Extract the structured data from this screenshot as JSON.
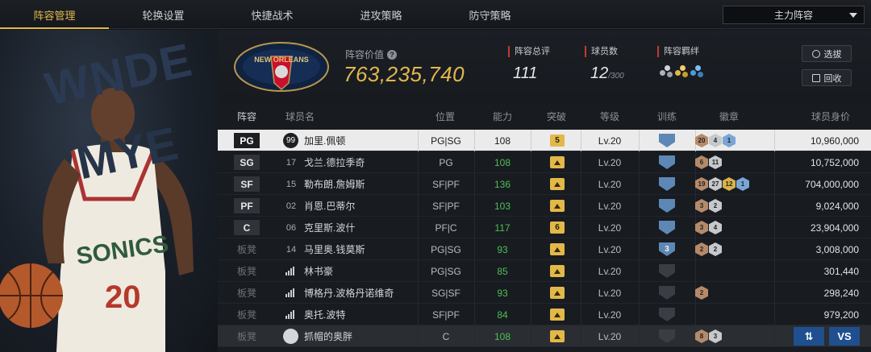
{
  "tabs": [
    "阵容管理",
    "轮换设置",
    "快捷战术",
    "进攻策略",
    "防守策略"
  ],
  "lineup_select": "主力阵容",
  "team_logo_text": "NEW ORLEANS",
  "value_label": "阵容价值",
  "value": "763,235,740",
  "stats": {
    "overall_label": "阵容总评",
    "overall": "111",
    "count_label": "球员数",
    "count": "12",
    "count_max": "/300",
    "synergy_label": "阵容羁绊"
  },
  "buttons": {
    "pick": "选拔",
    "recycle": "回收"
  },
  "headers": {
    "lineup": "阵容",
    "name": "球员名",
    "position": "位置",
    "ability": "能力",
    "break": "突破",
    "level": "等级",
    "train": "训练",
    "badge": "徽章",
    "salary": "球员身价"
  },
  "rows": [
    {
      "slot": "PG",
      "jersey": "99",
      "name": "加里.佩顿",
      "position": "PG|SG",
      "ability": "108",
      "break": "5",
      "level": "Lv.20",
      "train": "",
      "badges": [
        [
          "20",
          "bronze"
        ],
        [
          "4",
          "silver"
        ],
        [
          "1",
          "hof"
        ]
      ],
      "salary": "10,960,000"
    },
    {
      "slot": "SG",
      "jersey": "17",
      "name": "戈兰.德拉季奇",
      "position": "PG",
      "ability": "108",
      "break": "",
      "level": "Lv.20",
      "train": "",
      "badges": [
        [
          "6",
          "bronze"
        ],
        [
          "11",
          "silver"
        ]
      ],
      "salary": "10,752,000"
    },
    {
      "slot": "SF",
      "jersey": "15",
      "name": "勒布朗.詹姆斯",
      "position": "SF|PF",
      "ability": "136",
      "break": "",
      "level": "Lv.20",
      "train": "",
      "badges": [
        [
          "19",
          "bronze"
        ],
        [
          "27",
          "silver"
        ],
        [
          "12",
          "gold"
        ],
        [
          "1",
          "hof"
        ]
      ],
      "salary": "704,000,000"
    },
    {
      "slot": "PF",
      "jersey": "02",
      "name": "肖恩.巴蒂尔",
      "position": "SF|PF",
      "ability": "103",
      "break": "",
      "level": "Lv.20",
      "train": "",
      "badges": [
        [
          "3",
          "bronze"
        ],
        [
          "2",
          "silver"
        ]
      ],
      "salary": "9,024,000"
    },
    {
      "slot": "C",
      "jersey": "06",
      "name": "克里斯.波什",
      "position": "PF|C",
      "ability": "117",
      "break": "6",
      "level": "Lv.20",
      "train": "",
      "badges": [
        [
          "3",
          "bronze"
        ],
        [
          "4",
          "silver"
        ]
      ],
      "salary": "23,904,000"
    },
    {
      "slot": "板凳",
      "jersey": "14",
      "name": "马里奥.钱莫斯",
      "position": "PG|SG",
      "ability": "93",
      "break": "",
      "level": "Lv.20",
      "train": "3",
      "badges": [
        [
          "2",
          "bronze"
        ],
        [
          "2",
          "silver"
        ]
      ],
      "salary": "3,008,000"
    },
    {
      "slot": "板凳",
      "jersey": "",
      "name": "林书豪",
      "position": "PG|SG",
      "ability": "85",
      "break": "",
      "level": "Lv.20",
      "train": "",
      "badges": [],
      "salary": "301,440"
    },
    {
      "slot": "板凳",
      "jersey": "",
      "name": "博格丹.波格丹诺维奇",
      "position": "SG|SF",
      "ability": "93",
      "break": "",
      "level": "Lv.20",
      "train": "",
      "badges": [
        [
          "2",
          "bronze"
        ]
      ],
      "salary": "298,240"
    },
    {
      "slot": "板凳",
      "jersey": "",
      "name": "奥托.波特",
      "position": "SF|PF",
      "ability": "84",
      "break": "",
      "level": "Lv.20",
      "train": "",
      "badges": [],
      "salary": "979,200"
    },
    {
      "slot": "板凳",
      "jersey": "",
      "name": "抓帽的奥胖",
      "position": "C",
      "ability": "108",
      "break": "",
      "level": "Lv.20",
      "train": "",
      "badges": [
        [
          "8",
          "bronze"
        ],
        [
          "3",
          "silver"
        ]
      ],
      "salary": ""
    }
  ],
  "vs_label": "VS",
  "colors": {
    "accent": "#e2b74d",
    "ability": "#4fbf55",
    "train": "#5d88b5"
  }
}
